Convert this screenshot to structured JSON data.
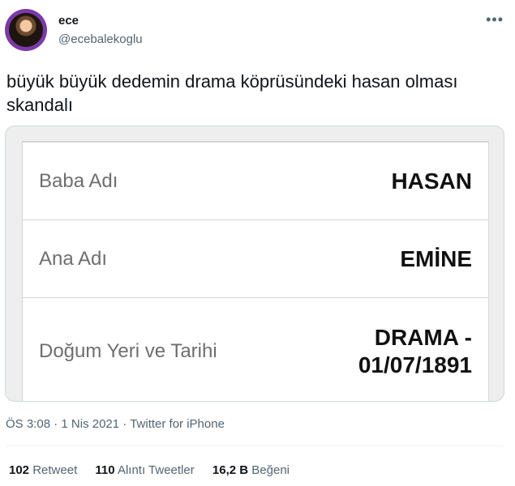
{
  "user": {
    "name": "ece",
    "handle": "@ecebalekoglu"
  },
  "tweet": {
    "text": "büyük büyük dedemin drama köprüsündeki hasan olması skandalı"
  },
  "record": {
    "rows": [
      {
        "label": "Baba Adı",
        "value": "HASAN"
      },
      {
        "label": "Ana Adı",
        "value": "EMİNE"
      },
      {
        "label": "Doğum Yeri ve Tarihi",
        "value_line1": "DRAMA -",
        "value_line2": "01/07/1891"
      }
    ]
  },
  "meta": {
    "time": "ÖS 3:08",
    "separator": "·",
    "date": "1 Nis 2021",
    "source": "Twitter for iPhone"
  },
  "stats": {
    "retweets_count": "102",
    "retweets_label": "Retweet",
    "quotes_count": "110",
    "quotes_label": "Alıntı Tweetler",
    "likes_count": "16,2 B",
    "likes_label": "Beğeni"
  },
  "colors": {
    "avatar_ring": "#7c3aa6",
    "secondary_text": "#536471",
    "border": "#cfd9de"
  },
  "icons": [
    "more-icon"
  ]
}
